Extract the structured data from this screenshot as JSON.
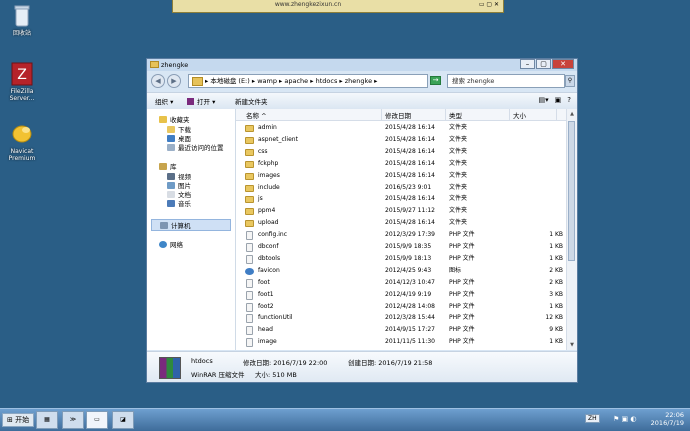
{
  "desktop": {
    "icons": [
      {
        "label": "回收站"
      },
      {
        "label": "FileZilla Server..."
      },
      {
        "label": "Navicat Premium"
      }
    ]
  },
  "bg_window": {
    "url": "www.zhengkezixun.cn"
  },
  "window": {
    "title": "zhengke",
    "address": [
      "本地磁盘 (E:)",
      "wamp",
      "apache",
      "htdocs",
      "zhengke"
    ],
    "search_placeholder": "搜索 zhengke",
    "toolbar": {
      "organize": "组织",
      "open": "打开",
      "new_folder": "新建文件夹"
    },
    "nav": {
      "favorites": "收藏夹",
      "downloads": "下载",
      "desktop": "桌面",
      "recent": "最近访问的位置",
      "libraries": "库",
      "videos": "视频",
      "pictures": "图片",
      "documents": "文档",
      "music": "音乐",
      "computer": "计算机",
      "network": "网络"
    },
    "columns": {
      "name": "名称",
      "date": "修改日期",
      "type": "类型",
      "size": "大小"
    },
    "files": [
      {
        "name": "admin",
        "date": "2015/4/28 16:14",
        "type": "文件夹",
        "size": "",
        "kind": "folder"
      },
      {
        "name": "aspnet_client",
        "date": "2015/4/28 16:14",
        "type": "文件夹",
        "size": "",
        "kind": "folder"
      },
      {
        "name": "css",
        "date": "2015/4/28 16:14",
        "type": "文件夹",
        "size": "",
        "kind": "folder"
      },
      {
        "name": "fckphp",
        "date": "2015/4/28 16:14",
        "type": "文件夹",
        "size": "",
        "kind": "folder"
      },
      {
        "name": "images",
        "date": "2015/4/28 16:14",
        "type": "文件夹",
        "size": "",
        "kind": "folder"
      },
      {
        "name": "include",
        "date": "2016/5/23 9:01",
        "type": "文件夹",
        "size": "",
        "kind": "folder"
      },
      {
        "name": "js",
        "date": "2015/4/28 16:14",
        "type": "文件夹",
        "size": "",
        "kind": "folder"
      },
      {
        "name": "ppm4",
        "date": "2015/9/27 11:12",
        "type": "文件夹",
        "size": "",
        "kind": "folder"
      },
      {
        "name": "upload",
        "date": "2015/4/28 16:14",
        "type": "文件夹",
        "size": "",
        "kind": "folder"
      },
      {
        "name": "config.inc",
        "date": "2012/3/29 17:39",
        "type": "PHP 文件",
        "size": "1 KB",
        "kind": "php"
      },
      {
        "name": "dbconf",
        "date": "2015/9/9 18:35",
        "type": "PHP 文件",
        "size": "1 KB",
        "kind": "php"
      },
      {
        "name": "dbtools",
        "date": "2015/9/9 18:13",
        "type": "PHP 文件",
        "size": "1 KB",
        "kind": "php"
      },
      {
        "name": "favicon",
        "date": "2012/4/25 9:43",
        "type": "图标",
        "size": "2 KB",
        "kind": "icon"
      },
      {
        "name": "foot",
        "date": "2014/12/3 10:47",
        "type": "PHP 文件",
        "size": "2 KB",
        "kind": "php"
      },
      {
        "name": "foot1",
        "date": "2012/4/19 9:19",
        "type": "PHP 文件",
        "size": "3 KB",
        "kind": "php"
      },
      {
        "name": "foot2",
        "date": "2012/4/28 14:08",
        "type": "PHP 文件",
        "size": "1 KB",
        "kind": "php"
      },
      {
        "name": "functionUtil",
        "date": "2012/3/28 15:44",
        "type": "PHP 文件",
        "size": "12 KB",
        "kind": "php"
      },
      {
        "name": "head",
        "date": "2014/9/15 17:27",
        "type": "PHP 文件",
        "size": "9 KB",
        "kind": "php"
      },
      {
        "name": "image",
        "date": "2011/11/5 11:30",
        "type": "PHP 文件",
        "size": "1 KB",
        "kind": "php"
      }
    ],
    "details": {
      "name": "htdocs",
      "filetype": "WinRAR 压缩文件",
      "modified_label": "修改日期:",
      "modified": "2016/7/19 22:00",
      "created_label": "创建日期:",
      "created": "2016/7/19 21:58",
      "size_label": "大小:",
      "size": "510 MB"
    }
  },
  "taskbar": {
    "start": "开始",
    "lang": "ZH",
    "time": "22:06",
    "date": "2016/7/19"
  }
}
